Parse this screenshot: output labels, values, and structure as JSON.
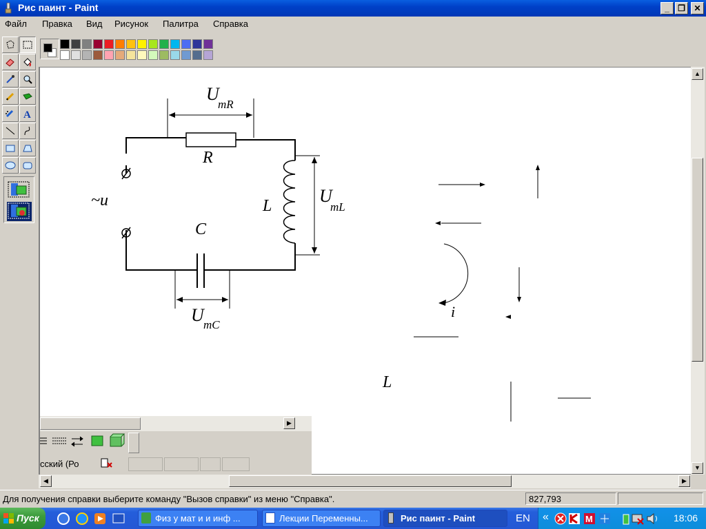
{
  "window": {
    "title": "Рис паинт - Paint",
    "controls": {
      "minimize": "_",
      "restore": "❐",
      "close": "✕"
    }
  },
  "menu": [
    "Файл",
    "Правка",
    "Вид",
    "Рисунок",
    "Палитра",
    "Справка"
  ],
  "palette": {
    "top_row": [
      "#000000",
      "#404040",
      "#808080",
      "#990030",
      "#ed1c24",
      "#ff7e00",
      "#ffc20e",
      "#fff200",
      "#a8e61d",
      "#22b14c",
      "#00b7ef",
      "#4d6df3",
      "#2f3699",
      "#6f3198"
    ],
    "bottom_row": [
      "#ffffff",
      "#e0e0e0",
      "#b4b4b4",
      "#9c5a3c",
      "#ffa3b1",
      "#e5aa7a",
      "#f5e49c",
      "#fff9bd",
      "#d3f9bc",
      "#9dbb61",
      "#99d9ea",
      "#709ad1",
      "#546d8e",
      "#b5a5d5"
    ],
    "foreground": "#000000",
    "background": "#ffffff"
  },
  "tools": [
    "free-select-icon",
    "rect-select-icon",
    "eraser-icon",
    "fill-icon",
    "eyedropper-icon",
    "magnifier-icon",
    "pencil-icon",
    "brush-icon",
    "airbrush-icon",
    "text-icon",
    "line-icon",
    "curve-icon",
    "rectangle-icon",
    "polygon-icon",
    "ellipse-icon",
    "rounded-rect-icon"
  ],
  "drawing": {
    "labels": {
      "umr_main": "U",
      "umr_sub": "mR",
      "r": "R",
      "source": "~u",
      "l_left": "L",
      "uml_main": "U",
      "uml_sub": "mL",
      "c": "C",
      "umc_main": "U",
      "umc_sub": "mC",
      "i": "i",
      "l_lower": "L"
    }
  },
  "fragment": {
    "lang_text": "сский (Ро"
  },
  "status": {
    "help": "Для получения справки выберите команду \"Вызов справки\" из меню \"Справка\".",
    "coords": "827,793"
  },
  "taskbar": {
    "start": "Пуск",
    "tasks": [
      "Физ у мат и и инф ...",
      "Лекции Переменны...",
      "Рис паинт - Paint"
    ],
    "lang": "EN",
    "tray_chevron": "«",
    "clock": "18:06"
  }
}
